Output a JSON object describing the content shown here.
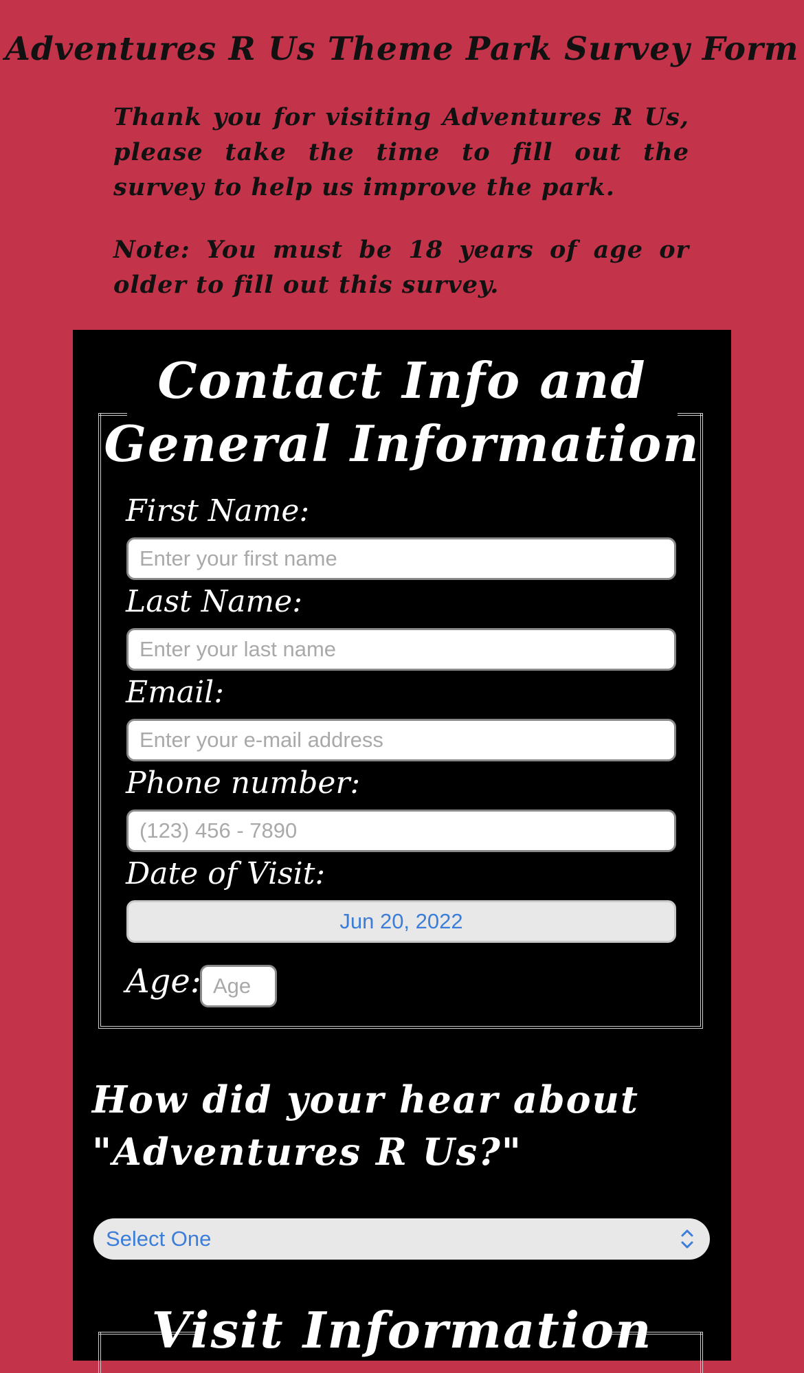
{
  "header": {
    "title": "Adventures R Us Theme Park Survey Form",
    "intro": "Thank you for visiting Adventures R Us, please take the time to fill out the survey to help us improve the park.",
    "note": "Note: You must be 18 years of age or older to fill out this survey."
  },
  "contact": {
    "legend_line1": "Contact Info and",
    "legend_line2": "General Information",
    "first_name_label": "First Name:",
    "first_name_placeholder": "Enter your first name",
    "last_name_label": "Last Name:",
    "last_name_placeholder": "Enter your last name",
    "email_label": "Email:",
    "email_placeholder": "Enter your e-mail address",
    "phone_label": "Phone number:",
    "phone_placeholder": "(123) 456 - 7890",
    "date_label": "Date of Visit:",
    "date_value": "Jun 20, 2022",
    "age_label": "Age:",
    "age_placeholder": "Age"
  },
  "referral": {
    "question_line1": "How did your hear about",
    "question_line2": "\"Adventures R Us?\"",
    "select_value": "Select One"
  },
  "visit": {
    "legend": "Visit Information"
  },
  "colors": {
    "background": "#c3344b",
    "panel": "#000000",
    "accent": "#3b7dd8"
  },
  "icons": {
    "select": "chevron-up-down-icon"
  }
}
